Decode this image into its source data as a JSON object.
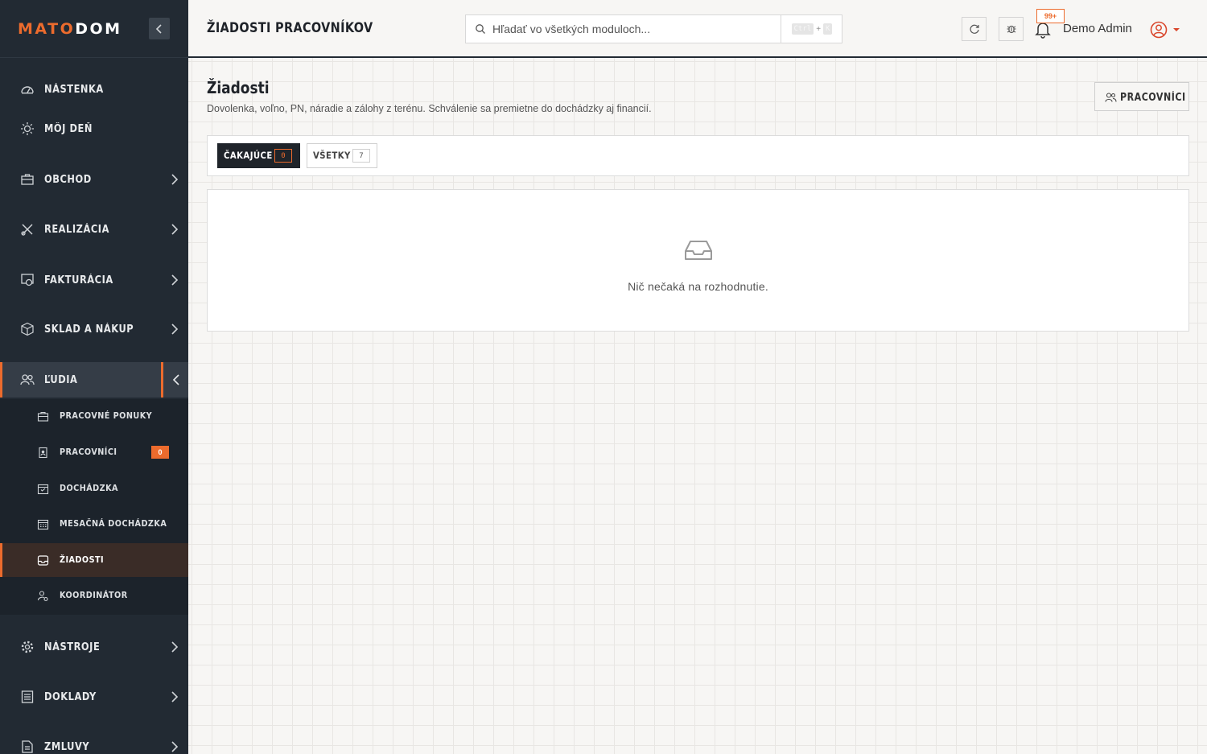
{
  "brand": {
    "logo_part1": "MATO",
    "logo_part2": "DOM",
    "accent": "#ec6b2d"
  },
  "sidebar": {
    "items": [
      {
        "label": "NÁSTENKA",
        "icon": "dashboard-icon"
      },
      {
        "label": "MÔJ DEŇ",
        "icon": "sun-icon"
      },
      {
        "label": "OBCHOD",
        "icon": "briefcase-icon"
      },
      {
        "label": "REALIZÁCIA",
        "icon": "tools-icon"
      },
      {
        "label": "FAKTURÁCIA",
        "icon": "invoice-icon"
      },
      {
        "label": "SKLAD A NÁKUP",
        "icon": "box-icon"
      },
      {
        "label": "ĽUDIA",
        "icon": "users-icon"
      },
      {
        "label": "NÁSTROJE",
        "icon": "gear-icon"
      },
      {
        "label": "DOKLADY",
        "icon": "document-list-icon"
      },
      {
        "label": "ZMLUVY",
        "icon": "contract-icon"
      }
    ],
    "sub_items": [
      {
        "label": "PRACOVNÉ PONUKY",
        "icon": "briefcase-icon"
      },
      {
        "label": "PRACOVNÍCI",
        "icon": "badge-icon",
        "badge": "0"
      },
      {
        "label": "DOCHÁDZKA",
        "icon": "calendar-check-icon"
      },
      {
        "label": "MESAČNÁ DOCHÁDZKA",
        "icon": "calendar-grid-icon"
      },
      {
        "label": "ŽIADOSTI",
        "icon": "inbox-icon"
      },
      {
        "label": "KOORDINÁTOR",
        "icon": "user-settings-icon"
      }
    ]
  },
  "topbar": {
    "title": "ŽIADOSTI PRACOVNÍKOV",
    "search_placeholder": "Hľadať vo všetkých moduloch...",
    "shortcut_key1": "Ctrl",
    "shortcut_plus": "+",
    "shortcut_key2": "K",
    "notifications_badge": "99+",
    "user_name": "Demo Admin"
  },
  "main": {
    "title": "Žiadosti",
    "subtitle": "Dovolenka, voľno, PN, náradie a zálohy z terénu. Schválenie sa premietne do dochádzky aj financií.",
    "workers_button": "PRACOVNÍCI",
    "tabs": [
      {
        "label": "ČAKAJÚCE",
        "count": "0"
      },
      {
        "label": "VŠETKY",
        "count": "7"
      }
    ],
    "empty_text": "Nič nečaká na rozhodnutie."
  }
}
